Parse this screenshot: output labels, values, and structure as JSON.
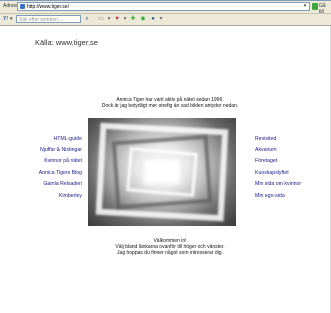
{
  "browser": {
    "address_label": "Adress",
    "url": "http://www.tiger.se/",
    "go_label": "Gå till",
    "search_placeholder": "Sök efter webben ...",
    "toolbar_logo": "Y!"
  },
  "page": {
    "source": "Källa: www.tiger.se",
    "intro": [
      "Annica Tiger har varit aktiv på nätet sedan 1996.",
      "Dock är jag betydligt mer otrefig än vad bilden antyder nedan."
    ],
    "left_links": [
      "HTML-guide",
      "Njuffar & Nistingar",
      "Kvinnor på nätet",
      "Annica Tigers Blog",
      "Gamla Relsaden",
      "Kimberley"
    ],
    "right_links": [
      "Revisited",
      "Akvarium",
      "Företaget",
      "Kunskapslyftet",
      "Min sida om kvinnor",
      "Min ego-sida"
    ],
    "outro": [
      "Välkommen in!",
      "Välj bland länkarna ovanför till höger och vänster.",
      "Jag hoppas du finner något som intresserar dig."
    ]
  }
}
